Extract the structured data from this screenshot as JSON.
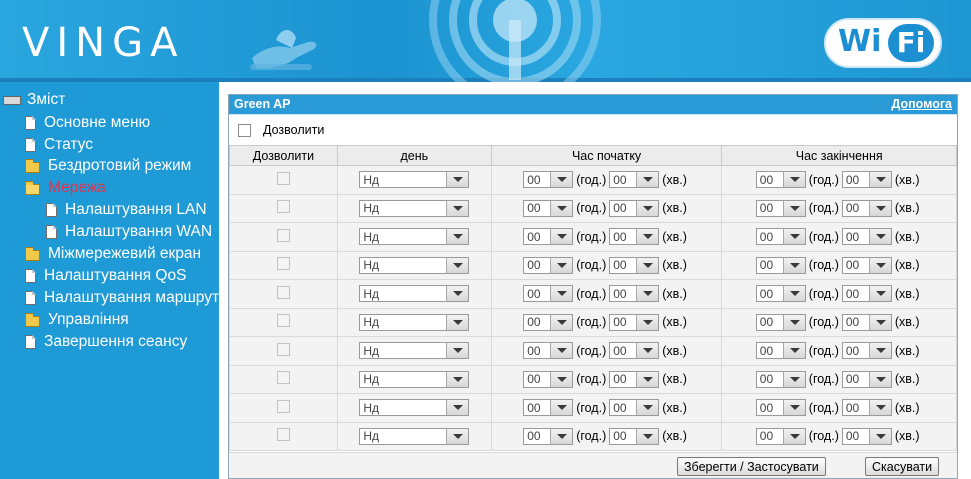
{
  "header": {
    "brand": "VINGA",
    "logo_left": "Wi",
    "logo_right": "Fi"
  },
  "sidebar": {
    "root_label": "Зміст",
    "items": [
      {
        "label": "Основне меню",
        "icon": "page-icon"
      },
      {
        "label": "Статус",
        "icon": "page-icon"
      },
      {
        "label": "Бездротовий режим",
        "icon": "folder-icon"
      },
      {
        "label": "Мережа",
        "icon": "folder-open-icon",
        "active": true
      },
      {
        "label": "Налаштування LAN",
        "icon": "page-icon"
      },
      {
        "label": "Налаштування WAN",
        "icon": "page-icon"
      },
      {
        "label": "Міжмережевий екран",
        "icon": "folder-icon"
      },
      {
        "label": "Налаштування QoS",
        "icon": "page-icon"
      },
      {
        "label": "Налаштування маршрутизації",
        "icon": "page-icon"
      },
      {
        "label": "Управління",
        "icon": "folder-icon"
      },
      {
        "label": "Завершення сеансу",
        "icon": "page-icon"
      }
    ]
  },
  "panel": {
    "title": "Green AP",
    "help_link": "Допомога",
    "enable_label": "Дозволити",
    "columns": {
      "enable": "Дозволити",
      "day": "день",
      "start": "Час початку",
      "end": "Час закінчення"
    },
    "units": {
      "hour": "(год.)",
      "minute": "(хв.)"
    },
    "rows": [
      {
        "day": "Нд",
        "start_h": "00",
        "start_m": "00",
        "end_h": "00",
        "end_m": "00"
      },
      {
        "day": "Нд",
        "start_h": "00",
        "start_m": "00",
        "end_h": "00",
        "end_m": "00"
      },
      {
        "day": "Нд",
        "start_h": "00",
        "start_m": "00",
        "end_h": "00",
        "end_m": "00"
      },
      {
        "day": "Нд",
        "start_h": "00",
        "start_m": "00",
        "end_h": "00",
        "end_m": "00"
      },
      {
        "day": "Нд",
        "start_h": "00",
        "start_m": "00",
        "end_h": "00",
        "end_m": "00"
      },
      {
        "day": "Нд",
        "start_h": "00",
        "start_m": "00",
        "end_h": "00",
        "end_m": "00"
      },
      {
        "day": "Нд",
        "start_h": "00",
        "start_m": "00",
        "end_h": "00",
        "end_m": "00"
      },
      {
        "day": "Нд",
        "start_h": "00",
        "start_m": "00",
        "end_h": "00",
        "end_m": "00"
      },
      {
        "day": "Нд",
        "start_h": "00",
        "start_m": "00",
        "end_h": "00",
        "end_m": "00"
      },
      {
        "day": "Нд",
        "start_h": "00",
        "start_m": "00",
        "end_h": "00",
        "end_m": "00"
      }
    ],
    "save_label": "Зберегти / Застосувати",
    "cancel_label": "Скасувати"
  }
}
